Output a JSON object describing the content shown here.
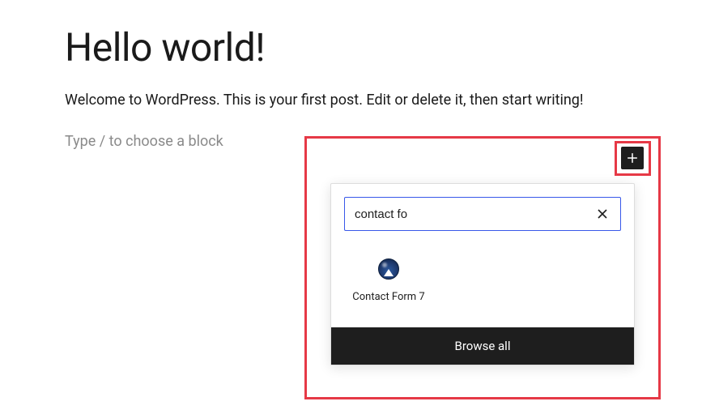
{
  "post": {
    "title": "Hello world!",
    "body": "Welcome to WordPress. This is your first post. Edit or delete it, then start writing!",
    "placeholder": "Type / to choose a block"
  },
  "inserter": {
    "search_value": "contact fo",
    "result": {
      "label": "Contact Form 7",
      "icon_name": "contact-form-7-icon"
    },
    "browse_all_label": "Browse all"
  }
}
